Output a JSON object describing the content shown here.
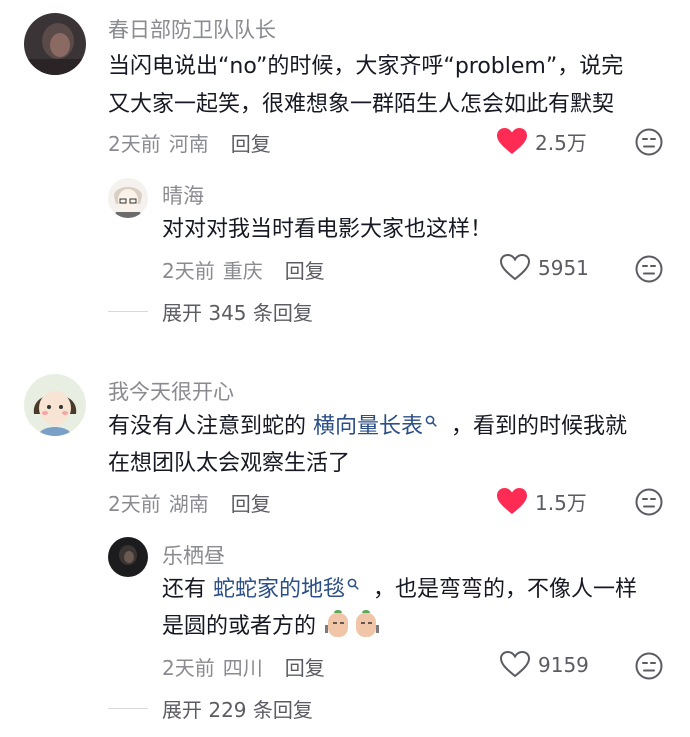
{
  "comments": [
    {
      "user": "春日部防卫队队长",
      "text_lines": [
        "当闪电说出“no”的时候，大家齐呼“problem”，说完",
        "又大家一起笑，很难想象一群陌生人怎会如此有默契"
      ],
      "time": "2天前",
      "location": "河南",
      "reply_label": "回复",
      "likes": "2.5万",
      "liked": true,
      "replies": [
        {
          "user": "晴海",
          "text": "对对对我当时看电影大家也这样！",
          "time": "2天前",
          "location": "重庆",
          "reply_label": "回复",
          "likes": "5951",
          "liked": false
        }
      ],
      "expand_label": "展开 345 条回复"
    },
    {
      "user": "我今天很开心",
      "text_line1_pre": "有没有人注意到蛇的",
      "text_line1_link": "横向量长表",
      "text_line1_post": "，看到的时候我就",
      "text_line2": "在想团队太会观察生活了",
      "time": "2天前",
      "location": "湖南",
      "reply_label": "回复",
      "likes": "1.5万",
      "liked": true,
      "replies": [
        {
          "user": "乐栖昼",
          "text_line1_pre": "还有",
          "text_line1_link": "蛇蛇家的地毯",
          "text_line1_post": "，也是弯弯的，不像人一样",
          "text_line2": "是圆的或者方的",
          "time": "2天前",
          "location": "四川",
          "reply_label": "回复",
          "likes": "9159",
          "liked": false
        }
      ],
      "expand_label": "展开 229 条回复"
    }
  ],
  "colors": {
    "heart_liked": "#fe2c55",
    "link": "#2b4f86",
    "meta": "#8a8b91"
  },
  "icons": [
    "heart-filled-icon",
    "heart-outline-icon",
    "dislike-face-icon",
    "search-icon",
    "sticker-emoji-icon"
  ]
}
